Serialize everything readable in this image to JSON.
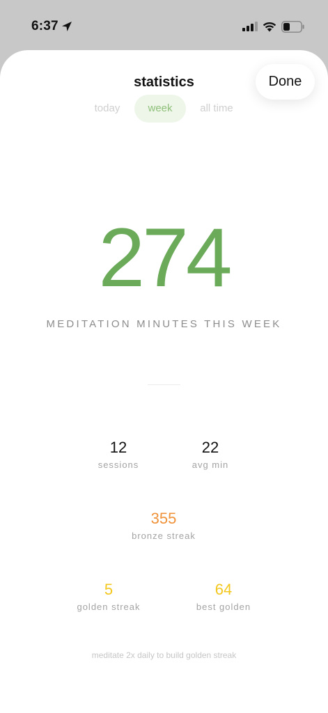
{
  "status_bar": {
    "time": "6:37",
    "icons": [
      "location-arrow-icon",
      "cellular-signal-icon",
      "wifi-icon",
      "battery-icon"
    ]
  },
  "header": {
    "title": "statistics",
    "done_label": "Done"
  },
  "tabs": [
    {
      "label": "today",
      "selected": false
    },
    {
      "label": "week",
      "selected": true
    },
    {
      "label": "all time",
      "selected": false
    }
  ],
  "summary": {
    "value": "274",
    "caption": "MEDITATION MINUTES THIS WEEK"
  },
  "stats": {
    "sessions": {
      "value": "12",
      "label": "sessions"
    },
    "avg_min": {
      "value": "22",
      "label": "avg min"
    },
    "bronze_streak": {
      "value": "355",
      "label": "bronze streak"
    },
    "golden_streak": {
      "value": "5",
      "label": "golden streak"
    },
    "best_golden": {
      "value": "64",
      "label": "best golden"
    }
  },
  "hint": "meditate 2x daily to build golden streak",
  "colors": {
    "accent_green": "#6aaa58",
    "tab_selected_bg": "#eef6ea",
    "bronze": "#f0923a",
    "golden": "#f3c71c"
  }
}
